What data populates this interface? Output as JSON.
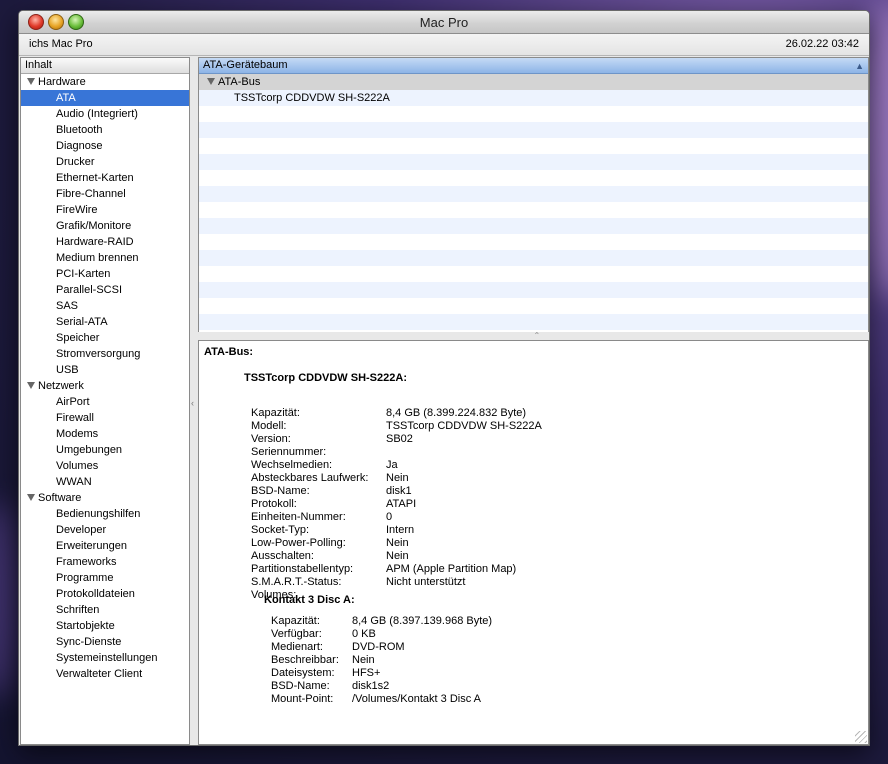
{
  "window": {
    "title": "Mac Pro",
    "computer_name": "ichs Mac Pro",
    "datetime": "26.02.22 03:42"
  },
  "sidebar": {
    "header": "Inhalt",
    "groups": [
      {
        "label": "Hardware",
        "items": [
          "ATA",
          "Audio (Integriert)",
          "Bluetooth",
          "Diagnose",
          "Drucker",
          "Ethernet-Karten",
          "Fibre-Channel",
          "FireWire",
          "Grafik/Monitore",
          "Hardware-RAID",
          "Medium brennen",
          "PCI-Karten",
          "Parallel-SCSI",
          "SAS",
          "Serial-ATA",
          "Speicher",
          "Stromversorgung",
          "USB"
        ]
      },
      {
        "label": "Netzwerk",
        "items": [
          "AirPort",
          "Firewall",
          "Modems",
          "Umgebungen",
          "Volumes",
          "WWAN"
        ]
      },
      {
        "label": "Software",
        "items": [
          "Bedienungshilfen",
          "Developer",
          "Erweiterungen",
          "Frameworks",
          "Programme",
          "Protokolldateien",
          "Schriften",
          "Startobjekte",
          "Sync-Dienste",
          "Systemeinstellungen",
          "Verwalteter Client"
        ]
      }
    ],
    "selected": "ATA"
  },
  "device_tree": {
    "header": "ATA-Gerätebaum",
    "sort_icon": "sort-ascending-icon",
    "bus": "ATA-Bus",
    "device": "TSSTcorp CDDVDW SH-S222A"
  },
  "details": {
    "bus_heading": "ATA-Bus:",
    "device_heading": "TSSTcorp CDDVDW SH-S222A:",
    "properties": [
      {
        "key": "Kapazität:",
        "value": "8,4 GB (8.399.224.832 Byte)"
      },
      {
        "key": "Modell:",
        "value": "TSSTcorp CDDVDW SH-S222A"
      },
      {
        "key": "Version:",
        "value": "SB02"
      },
      {
        "key": "Seriennummer:",
        "value": ""
      },
      {
        "key": "Wechselmedien:",
        "value": "Ja"
      },
      {
        "key": "Absteckbares Laufwerk:",
        "value": "Nein"
      },
      {
        "key": "BSD-Name:",
        "value": "disk1"
      },
      {
        "key": "Protokoll:",
        "value": "ATAPI"
      },
      {
        "key": "Einheiten-Nummer:",
        "value": "0"
      },
      {
        "key": "Socket-Typ:",
        "value": "Intern"
      },
      {
        "key": "Low-Power-Polling:",
        "value": "Nein"
      },
      {
        "key": "Ausschalten:",
        "value": "Nein"
      },
      {
        "key": "Partitionstabellentyp:",
        "value": "APM (Apple Partition Map)"
      },
      {
        "key": "S.M.A.R.T.-Status:",
        "value": "Nicht unterstützt"
      },
      {
        "key": "Volumes:",
        "value": ""
      }
    ],
    "volume_heading": "Kontakt 3 Disc A:",
    "volume_properties": [
      {
        "key": "Kapazität:",
        "value": "8,4 GB (8.397.139.968 Byte)"
      },
      {
        "key": "Verfügbar:",
        "value": "0 KB"
      },
      {
        "key": "Medienart:",
        "value": "DVD-ROM"
      },
      {
        "key": "Beschreibbar:",
        "value": "Nein"
      },
      {
        "key": "Dateisystem:",
        "value": "HFS+"
      },
      {
        "key": "BSD-Name:",
        "value": "disk1s2"
      },
      {
        "key": "Mount-Point:",
        "value": "/Volumes/Kontakt 3 Disc A"
      }
    ]
  }
}
